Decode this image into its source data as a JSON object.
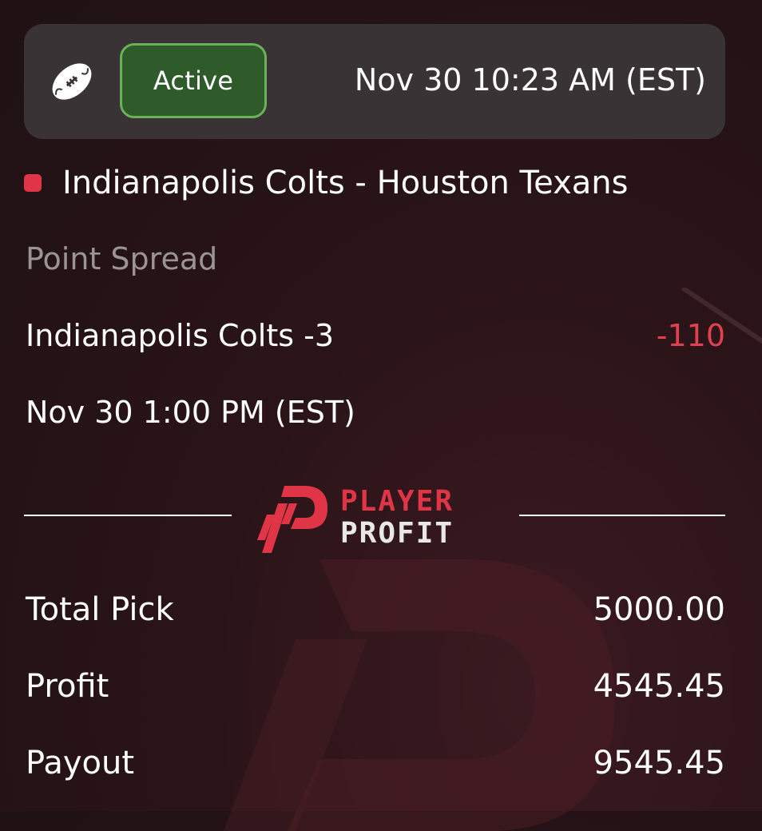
{
  "colors": {
    "active_badge_bg": "#2f5a2a",
    "active_badge_border": "#6db05a",
    "odds_negative": "#e03546",
    "brand_red": "#e03546",
    "muted_text": "#9a9496"
  },
  "header": {
    "sport_icon": "football-icon",
    "status": "Active",
    "placed_time": "Nov 30 10:23 AM (EST)"
  },
  "bet": {
    "matchup": "Indianapolis Colts - Houston Texans",
    "market": "Point Spread",
    "selection": "Indianapolis Colts -3",
    "odds": "-110",
    "event_time": "Nov 30 1:00 PM (EST)"
  },
  "brand": {
    "line1": "PLAYER",
    "line2": "PROFIT"
  },
  "summary": [
    {
      "label": "Total Pick",
      "value": "5000.00"
    },
    {
      "label": "Profit",
      "value": "4545.45"
    },
    {
      "label": "Payout",
      "value": "9545.45"
    }
  ]
}
